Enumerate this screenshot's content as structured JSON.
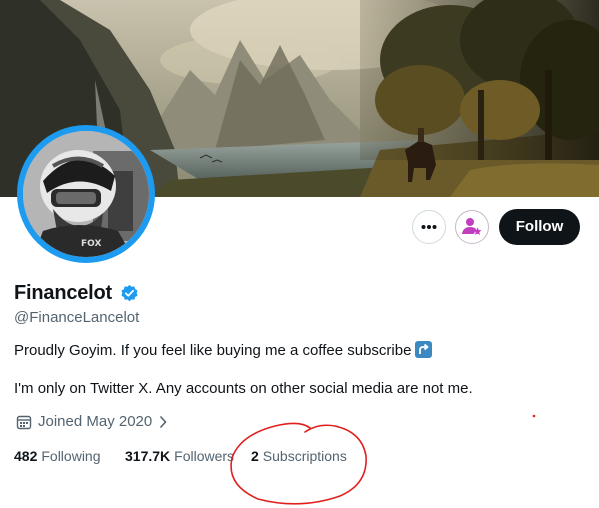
{
  "profile": {
    "name": "Financelot",
    "handle": "@FinanceLancelot",
    "bio_line1": "Proudly Goyim. If you feel like buying me a coffee subscribe",
    "bio_line2": "I'm only on Twitter X. Any accounts on other social media are not me.",
    "joined": "Joined May 2020"
  },
  "actions": {
    "follow_label": "Follow"
  },
  "stats": {
    "following_count": "482",
    "following_label": "Following",
    "followers_count": "317.7K",
    "followers_label": "Followers",
    "subscriptions_count": "2",
    "subscriptions_label": "Subscriptions"
  },
  "icons": {
    "more": "more-icon",
    "subscribe": "user-star-icon",
    "verified": "verified-badge-icon",
    "calendar": "calendar-icon",
    "chevron": "chevron-right-icon",
    "bio_emoji": "arrow-up-right-emoji"
  },
  "colors": {
    "accent": "#1d9bf0",
    "text": "#0f1419",
    "muted": "#536471",
    "follow_bg": "#0f1419",
    "subscribe_icon": "#c13fbf",
    "annotation": "#e0201f"
  }
}
